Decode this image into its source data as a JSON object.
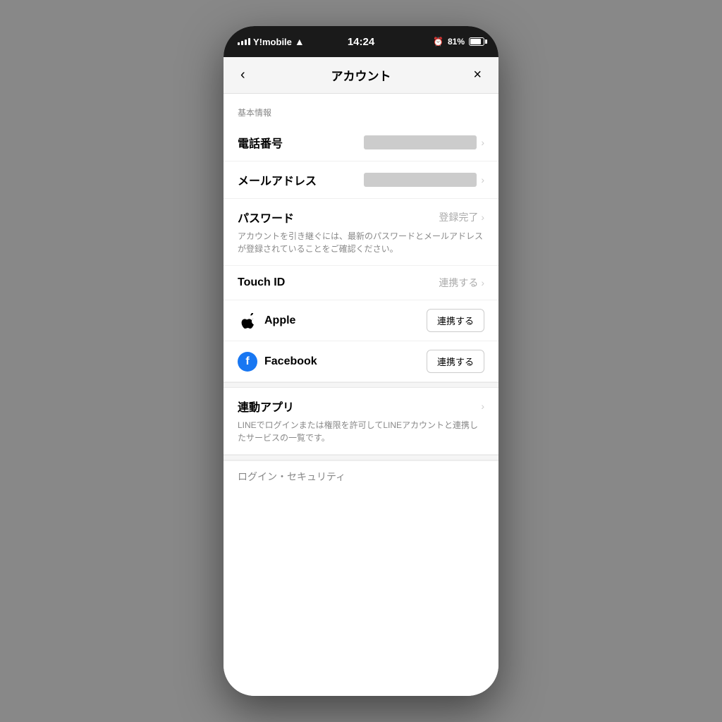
{
  "statusBar": {
    "carrier": "Y!mobile",
    "time": "14:24",
    "alarm": "🕐",
    "battery": "81%"
  },
  "header": {
    "back_label": "‹",
    "title": "アカウント",
    "close_label": "×"
  },
  "basicInfo": {
    "section_label": "基本情報",
    "phone": {
      "label": "電話番号",
      "value": ""
    },
    "email": {
      "label": "メールアドレス",
      "value": ""
    },
    "password": {
      "label": "パスワード",
      "status": "登録完了",
      "description": "アカウントを引き継ぐには、最新のパスワードとメールアドレスが登録されていることをご確認ください。"
    },
    "touchId": {
      "label": "Touch ID",
      "link": "連携する"
    }
  },
  "socialAccounts": {
    "apple": {
      "name": "Apple",
      "button": "連携する"
    },
    "facebook": {
      "name": "Facebook",
      "button": "連携する"
    }
  },
  "linkedApps": {
    "label": "連動アプリ",
    "description": "LINEでログインまたは権限を許可してLINEアカウントと連携したサービスの一覧です。"
  },
  "loginSecurity": {
    "label": "ログイン・セキュリティ"
  }
}
